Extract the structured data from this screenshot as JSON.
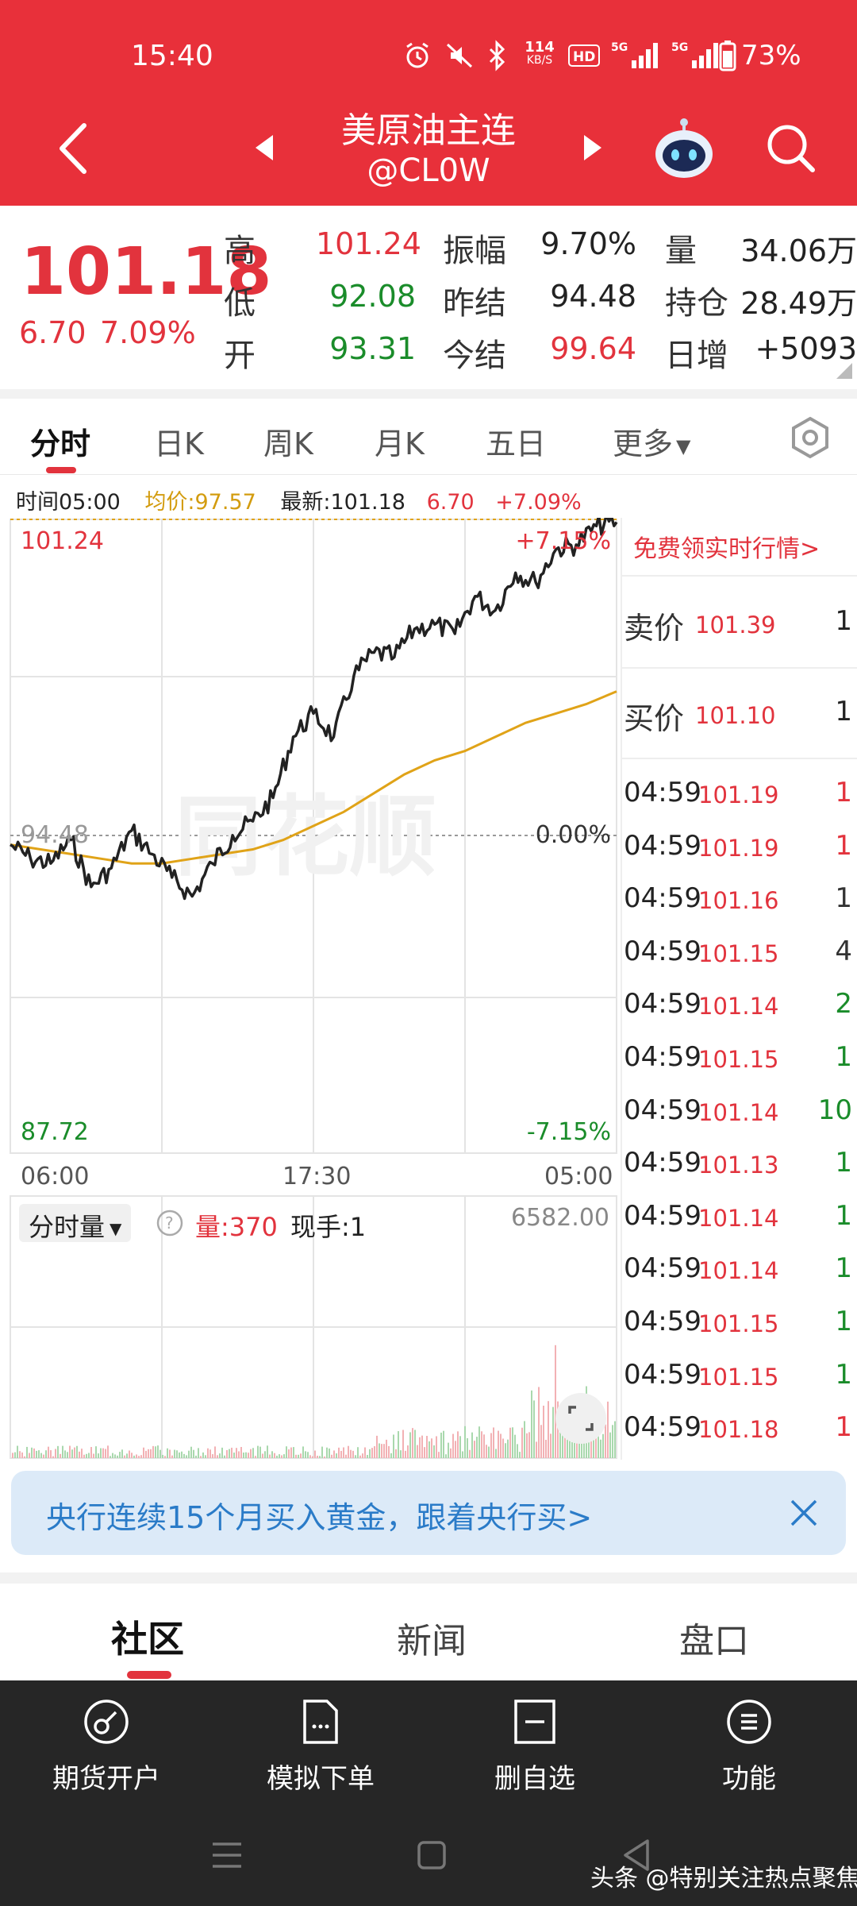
{
  "status_bar": {
    "time": "15:40",
    "net_speed_top": "114",
    "net_speed_bottom": "KB/S",
    "battery": "73%"
  },
  "header": {
    "title": "美原油主连",
    "code": "@CL0W"
  },
  "quote": {
    "price": "101.18",
    "change": "6.70",
    "change_pct": "7.09%",
    "high_label": "高",
    "high": "101.24",
    "low_label": "低",
    "low": "92.08",
    "open_label": "开",
    "open": "93.31",
    "amplitude_label": "振幅",
    "amplitude": "9.70%",
    "prev_settle_label": "昨结",
    "prev_settle": "94.48",
    "today_settle_label": "今结",
    "today_settle": "99.64",
    "volume_label": "量",
    "volume": "34.06万",
    "oi_label": "持仓",
    "oi": "28.49万",
    "daily_inc_label": "日增",
    "daily_inc": "+5093"
  },
  "tabs": [
    "分时",
    "日K",
    "周K",
    "月K",
    "五日",
    "更多"
  ],
  "info_line": {
    "time": "时间05:00",
    "avg": "均价:97.57",
    "latest": "最新:101.18",
    "chg": "6.70",
    "pct": "+7.09%"
  },
  "chart": {
    "top_price": "101.24",
    "top_pct": "+7.15%",
    "mid_price": "94.48",
    "mid_pct": "0.00%",
    "bottom_price": "87.72",
    "bottom_pct": "-7.15%",
    "times": [
      "06:00",
      "17:30",
      "05:00"
    ],
    "vol_label": "分时量",
    "vol_qty": "量:370",
    "vol_hand": "现手:1",
    "vol_max": "6582.00"
  },
  "chart_data": [
    {
      "type": "line",
      "x": [
        "06:00",
        "17:30",
        "05:00"
      ],
      "ylim": [
        87.72,
        101.24
      ],
      "series": [
        {
          "name": "价格",
          "color": "#222222",
          "values": [
            94.3,
            94.0,
            93.9,
            94.4,
            93.4,
            93.8,
            94.6,
            94.1,
            93.6,
            93.2,
            93.9,
            94.5,
            94.8,
            95.3,
            96.6,
            97.1,
            96.6,
            97.9,
            98.4,
            98.3,
            98.9,
            99.0,
            98.8,
            99.6,
            99.3,
            100.1,
            99.9,
            100.6,
            100.7,
            101.1,
            101.18
          ]
        },
        {
          "name": "均价",
          "color": "#E0A318",
          "values": [
            94.3,
            94.2,
            94.1,
            94.0,
            93.9,
            93.9,
            94.0,
            94.1,
            94.2,
            94.4,
            94.7,
            95.0,
            95.4,
            95.8,
            96.1,
            96.3,
            96.6,
            96.9,
            97.1,
            97.3,
            97.57
          ]
        }
      ]
    }
  ],
  "sidepanel": {
    "promo": "免费领实时行情>",
    "ask_label": "卖价",
    "ask_price": "101.39",
    "ask_qty": "1",
    "bid_label": "买价",
    "bid_price": "101.10",
    "bid_qty": "1",
    "ticks": [
      {
        "time": "04:59",
        "price": "101.19",
        "qty": "1",
        "color": "#E2333D"
      },
      {
        "time": "04:59",
        "price": "101.19",
        "qty": "1",
        "color": "#E2333D"
      },
      {
        "time": "04:59",
        "price": "101.16",
        "qty": "1",
        "color": "#333333"
      },
      {
        "time": "04:59",
        "price": "101.15",
        "qty": "4",
        "color": "#333333"
      },
      {
        "time": "04:59",
        "price": "101.14",
        "qty": "2",
        "color": "#1A8C2A"
      },
      {
        "time": "04:59",
        "price": "101.15",
        "qty": "1",
        "color": "#1A8C2A"
      },
      {
        "time": "04:59",
        "price": "101.14",
        "qty": "10",
        "color": "#1A8C2A"
      },
      {
        "time": "04:59",
        "price": "101.13",
        "qty": "1",
        "color": "#1A8C2A"
      },
      {
        "time": "04:59",
        "price": "101.14",
        "qty": "1",
        "color": "#1A8C2A"
      },
      {
        "time": "04:59",
        "price": "101.14",
        "qty": "1",
        "color": "#1A8C2A"
      },
      {
        "time": "04:59",
        "price": "101.15",
        "qty": "1",
        "color": "#1A8C2A"
      },
      {
        "time": "04:59",
        "price": "101.15",
        "qty": "1",
        "color": "#1A8C2A"
      },
      {
        "time": "04:59",
        "price": "101.18",
        "qty": "1",
        "color": "#E2333D"
      }
    ]
  },
  "banner": {
    "text": "央行连续15个月买入黄金，跟着央行买>"
  },
  "section_tabs": [
    "社区",
    "新闻",
    "盘口"
  ],
  "bottom_nav": [
    {
      "label": "期货开户",
      "icon": "account-open-icon"
    },
    {
      "label": "模拟下单",
      "icon": "simulate-order-icon"
    },
    {
      "label": "删自选",
      "icon": "remove-watchlist-icon"
    },
    {
      "label": "功能",
      "icon": "menu-icon"
    }
  ],
  "watermark": "头条 @特别关注热点聚焦",
  "colors": {
    "brand": "#E8303A",
    "up": "#E2333D",
    "down": "#1A8C2A",
    "avg_line": "#E0A318"
  }
}
